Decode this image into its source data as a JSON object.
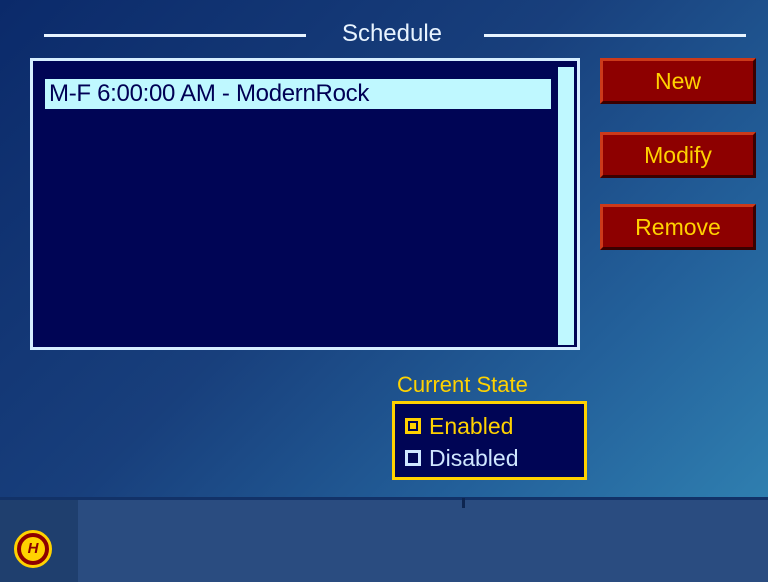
{
  "section": {
    "title": "Schedule"
  },
  "schedule_list": {
    "items": [
      {
        "label": "M-F 6:00:00 AM - ModernRock",
        "selected": true
      }
    ]
  },
  "buttons": {
    "new": "New",
    "modify": "Modify",
    "remove": "Remove"
  },
  "current_state": {
    "title": "Current State",
    "options": [
      {
        "label": "Enabled",
        "checked": true
      },
      {
        "label": "Disabled",
        "checked": false
      }
    ]
  },
  "footer": {
    "logo_letter": "H"
  },
  "colors": {
    "list_bg": "#000555",
    "selection": "#bff8ff",
    "button_bg": "#8d0000",
    "button_text": "#ffd200",
    "accent": "#ffd200"
  }
}
